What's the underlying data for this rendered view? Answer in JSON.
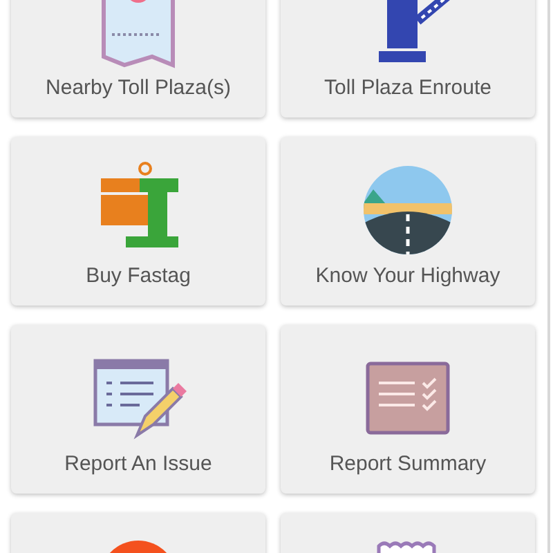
{
  "tiles": [
    {
      "label": "Nearby Toll Plaza(s)",
      "kind": "map"
    },
    {
      "label": "Toll Plaza Enroute",
      "kind": "barrier"
    },
    {
      "label": "Buy Fastag",
      "kind": "fastag"
    },
    {
      "label": "Know Your Highway",
      "kind": "highway"
    },
    {
      "label": "Report An Issue",
      "kind": "issue"
    },
    {
      "label": "Report Summary",
      "kind": "summary"
    },
    {
      "kind": "circle"
    },
    {
      "kind": "wavy"
    }
  ]
}
